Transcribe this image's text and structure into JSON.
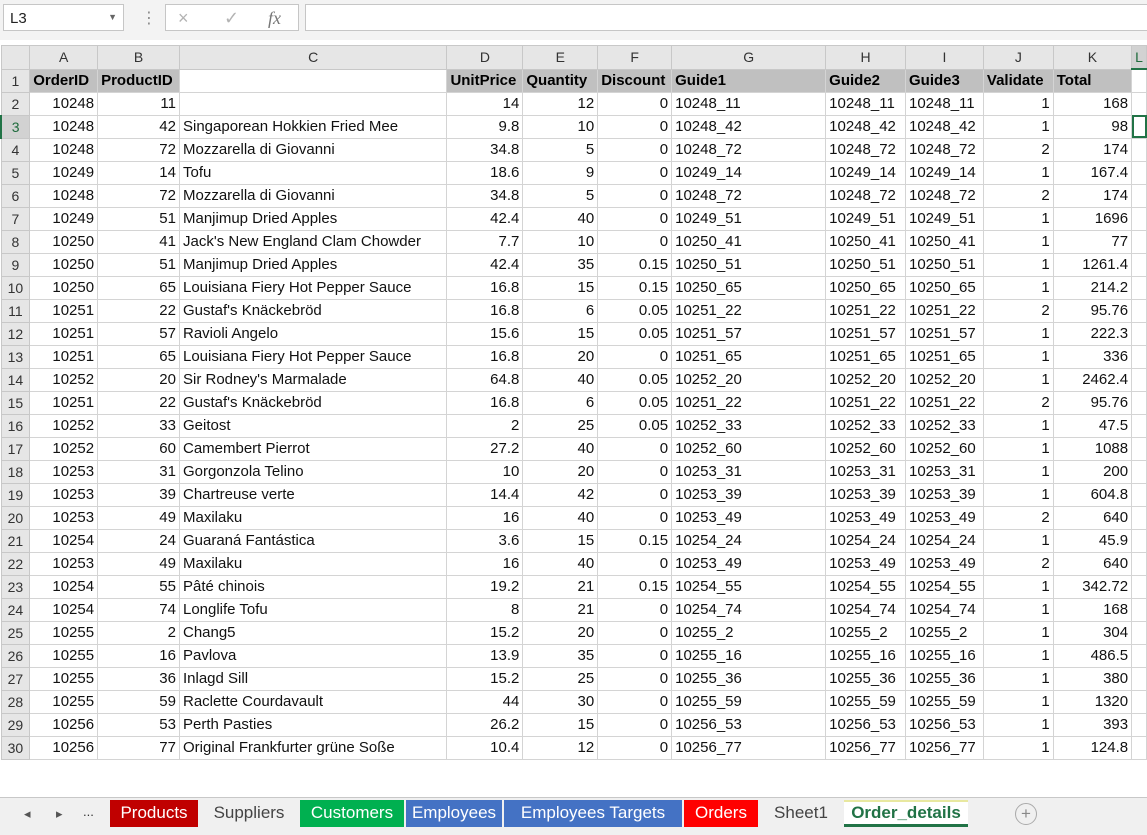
{
  "name_box": {
    "value": "L3"
  },
  "formula_bar": {
    "menu_icon": "vertical-dots-icon",
    "cancel_icon": "×",
    "enter_icon": "✓",
    "fx_label": "fx",
    "value": ""
  },
  "columns": [
    "A",
    "B",
    "C",
    "D",
    "E",
    "F",
    "G",
    "H",
    "I",
    "J",
    "K"
  ],
  "selected_column": "L",
  "selected_row": 3,
  "header_row": [
    "OrderID",
    "ProductID",
    "",
    "UnitPrice",
    "Quantity",
    "Discount",
    "Guide1",
    "Guide2",
    "Guide3",
    "Validate",
    "Total"
  ],
  "rows": [
    [
      "10248",
      "11",
      "",
      "14",
      "12",
      "0",
      "10248_11",
      "10248_11",
      "10248_11",
      "1",
      "168"
    ],
    [
      "10248",
      "42",
      "Singaporean Hokkien Fried Mee",
      "9.8",
      "10",
      "0",
      "10248_42",
      "10248_42",
      "10248_42",
      "1",
      "98"
    ],
    [
      "10248",
      "72",
      "Mozzarella di Giovanni",
      "34.8",
      "5",
      "0",
      "10248_72",
      "10248_72",
      "10248_72",
      "2",
      "174"
    ],
    [
      "10249",
      "14",
      "Tofu",
      "18.6",
      "9",
      "0",
      "10249_14",
      "10249_14",
      "10249_14",
      "1",
      "167.4"
    ],
    [
      "10248",
      "72",
      "Mozzarella di Giovanni",
      "34.8",
      "5",
      "0",
      "10248_72",
      "10248_72",
      "10248_72",
      "2",
      "174"
    ],
    [
      "10249",
      "51",
      "Manjimup Dried Apples",
      "42.4",
      "40",
      "0",
      "10249_51",
      "10249_51",
      "10249_51",
      "1",
      "1696"
    ],
    [
      "10250",
      "41",
      "Jack's New England Clam Chowder",
      "7.7",
      "10",
      "0",
      "10250_41",
      "10250_41",
      "10250_41",
      "1",
      "77"
    ],
    [
      "10250",
      "51",
      "Manjimup Dried Apples",
      "42.4",
      "35",
      "0.15",
      "10250_51",
      "10250_51",
      "10250_51",
      "1",
      "1261.4"
    ],
    [
      "10250",
      "65",
      "Louisiana Fiery Hot Pepper Sauce",
      "16.8",
      "15",
      "0.15",
      "10250_65",
      "10250_65",
      "10250_65",
      "1",
      "214.2"
    ],
    [
      "10251",
      "22",
      "Gustaf's Knäckebröd",
      "16.8",
      "6",
      "0.05",
      "10251_22",
      "10251_22",
      "10251_22",
      "2",
      "95.76"
    ],
    [
      "10251",
      "57",
      "Ravioli Angelo",
      "15.6",
      "15",
      "0.05",
      "10251_57",
      "10251_57",
      "10251_57",
      "1",
      "222.3"
    ],
    [
      "10251",
      "65",
      "Louisiana Fiery Hot Pepper Sauce",
      "16.8",
      "20",
      "0",
      "10251_65",
      "10251_65",
      "10251_65",
      "1",
      "336"
    ],
    [
      "10252",
      "20",
      "Sir Rodney's Marmalade",
      "64.8",
      "40",
      "0.05",
      "10252_20",
      "10252_20",
      "10252_20",
      "1",
      "2462.4"
    ],
    [
      "10251",
      "22",
      "Gustaf's Knäckebröd",
      "16.8",
      "6",
      "0.05",
      "10251_22",
      "10251_22",
      "10251_22",
      "2",
      "95.76"
    ],
    [
      "10252",
      "33",
      "Geitost",
      "2",
      "25",
      "0.05",
      "10252_33",
      "10252_33",
      "10252_33",
      "1",
      "47.5"
    ],
    [
      "10252",
      "60",
      "Camembert Pierrot",
      "27.2",
      "40",
      "0",
      "10252_60",
      "10252_60",
      "10252_60",
      "1",
      "1088"
    ],
    [
      "10253",
      "31",
      "Gorgonzola Telino",
      "10",
      "20",
      "0",
      "10253_31",
      "10253_31",
      "10253_31",
      "1",
      "200"
    ],
    [
      "10253",
      "39",
      "Chartreuse verte",
      "14.4",
      "42",
      "0",
      "10253_39",
      "10253_39",
      "10253_39",
      "1",
      "604.8"
    ],
    [
      "10253",
      "49",
      "Maxilaku",
      "16",
      "40",
      "0",
      "10253_49",
      "10253_49",
      "10253_49",
      "2",
      "640"
    ],
    [
      "10254",
      "24",
      "Guaraná Fantástica",
      "3.6",
      "15",
      "0.15",
      "10254_24",
      "10254_24",
      "10254_24",
      "1",
      "45.9"
    ],
    [
      "10253",
      "49",
      "Maxilaku",
      "16",
      "40",
      "0",
      "10253_49",
      "10253_49",
      "10253_49",
      "2",
      "640"
    ],
    [
      "10254",
      "55",
      "Pâté chinois",
      "19.2",
      "21",
      "0.15",
      "10254_55",
      "10254_55",
      "10254_55",
      "1",
      "342.72"
    ],
    [
      "10254",
      "74",
      "Longlife Tofu",
      "8",
      "21",
      "0",
      "10254_74",
      "10254_74",
      "10254_74",
      "1",
      "168"
    ],
    [
      "10255",
      "2",
      "Chang5",
      "15.2",
      "20",
      "0",
      "10255_2",
      "10255_2",
      "10255_2",
      "1",
      "304"
    ],
    [
      "10255",
      "16",
      "Pavlova",
      "13.9",
      "35",
      "0",
      "10255_16",
      "10255_16",
      "10255_16",
      "1",
      "486.5"
    ],
    [
      "10255",
      "36",
      "Inlagd Sill",
      "15.2",
      "25",
      "0",
      "10255_36",
      "10255_36",
      "10255_36",
      "1",
      "380"
    ],
    [
      "10255",
      "59",
      "Raclette Courdavault",
      "44",
      "30",
      "0",
      "10255_59",
      "10255_59",
      "10255_59",
      "1",
      "1320"
    ],
    [
      "10256",
      "53",
      "Perth Pasties",
      "26.2",
      "15",
      "0",
      "10256_53",
      "10256_53",
      "10256_53",
      "1",
      "393"
    ],
    [
      "10256",
      "77",
      "Original Frankfurter grüne Soße",
      "10.4",
      "12",
      "0",
      "10256_77",
      "10256_77",
      "10256_77",
      "1",
      "124.8"
    ]
  ],
  "sheet_nav": {
    "prev": "◂",
    "next": "▸",
    "more": "..."
  },
  "sheet_tabs": [
    {
      "label": "Products",
      "color": "#c00000"
    },
    {
      "label": "Suppliers",
      "color": ""
    },
    {
      "label": "Customers",
      "color": "#00b050"
    },
    {
      "label": "Employees",
      "color": "#4472c4"
    },
    {
      "label": "Employees Targets",
      "color": "#4472c4"
    },
    {
      "label": "Orders",
      "color": "#ff0000"
    },
    {
      "label": "Sheet1",
      "color": ""
    },
    {
      "label": "Order_details",
      "color": "#217346",
      "active": true
    }
  ],
  "add_sheet": "+"
}
